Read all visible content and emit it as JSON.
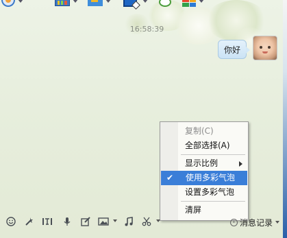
{
  "chat": {
    "timestamp": "16:58:39",
    "message": "你好"
  },
  "context_menu": {
    "items": [
      {
        "label": "复制(C)",
        "disabled": true
      },
      {
        "label": "全部选择(A)"
      },
      {
        "separator": true
      },
      {
        "label": "显示比例",
        "submenu": true
      },
      {
        "label": "使用多彩气泡",
        "checked": true,
        "highlighted": true
      },
      {
        "label": "设置多彩气泡"
      },
      {
        "separator": true
      },
      {
        "label": "清屏"
      }
    ]
  },
  "bottom_bar": {
    "history_label": "消息记录"
  },
  "icons": {
    "top": [
      "video-call-icon",
      "app-icon",
      "file-transfer-icon",
      "remote-desktop-icon",
      "chat-bubble-icon",
      "apps-icon"
    ],
    "bottom": [
      "emoji-icon",
      "shake-icon",
      "font-icon",
      "voice-icon",
      "edit-icon",
      "image-icon",
      "music-icon",
      "screenshot-icon"
    ],
    "check": "✔"
  },
  "colors": {
    "highlight": "#3a7ed8",
    "bubble": "#cbe3f5"
  }
}
